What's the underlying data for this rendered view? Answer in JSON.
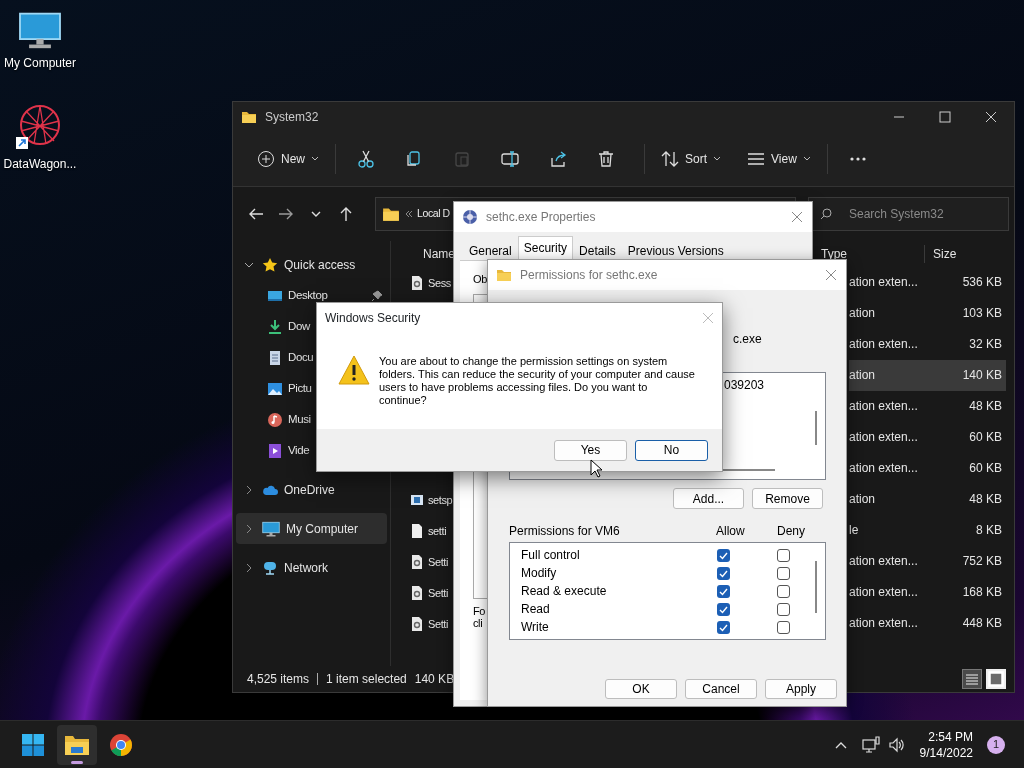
{
  "desktop_icons": [
    {
      "label": "My Computer",
      "kind": "computer"
    },
    {
      "label": "DataWagon...",
      "kind": "app"
    }
  ],
  "explorer": {
    "title": "System32",
    "toolbar": [
      {
        "kind": "new",
        "label": "New",
        "disabled": false
      },
      {
        "kind": "cut",
        "disabled": false
      },
      {
        "kind": "copy",
        "disabled": false
      },
      {
        "kind": "paste",
        "disabled": true
      },
      {
        "kind": "rename",
        "disabled": false
      },
      {
        "kind": "share",
        "disabled": false
      },
      {
        "kind": "delete",
        "disabled": false
      },
      {
        "kind": "sort",
        "label": "Sort",
        "disabled": false
      },
      {
        "kind": "view",
        "label": "View",
        "disabled": false
      },
      {
        "kind": "more",
        "disabled": false
      }
    ],
    "address": "Local D",
    "search": {
      "placeholder": "Search System32"
    },
    "sidebar": [
      {
        "label": "Quick access",
        "kind": "star",
        "expanded": true,
        "selected": false,
        "children": [
          {
            "label": "Desktop",
            "kind": "desktop",
            "pinned": true,
            "selected": false
          },
          {
            "label": "Dow",
            "kind": "downloads",
            "selected": false
          },
          {
            "label": "Docu",
            "kind": "documents",
            "selected": false
          },
          {
            "label": "Pictu",
            "kind": "pictures",
            "selected": false
          },
          {
            "label": "Musi",
            "kind": "music",
            "selected": false
          },
          {
            "label": "Vide",
            "kind": "videos",
            "selected": false
          }
        ]
      },
      {
        "label": "OneDrive",
        "kind": "cloud",
        "expanded": false,
        "selected": false
      },
      {
        "label": "My Computer",
        "kind": "computer",
        "expanded": false,
        "selected": true
      },
      {
        "label": "Network",
        "kind": "network",
        "expanded": false,
        "selected": false
      }
    ],
    "columns": [
      "Name",
      "Type",
      "Size"
    ],
    "rows": [
      {
        "name": "Sess",
        "kind": "settings",
        "type": "ation exten...",
        "size": "536 KB",
        "selected": false
      },
      {
        "type": "ation",
        "size": "103 KB",
        "selected": false
      },
      {
        "type": "ation exten...",
        "size": "32 KB",
        "selected": false
      },
      {
        "type": "ation",
        "size": "140 KB",
        "selected": true
      },
      {
        "type": "ation exten...",
        "size": "48 KB",
        "selected": false
      },
      {
        "type": "ation exten...",
        "size": "60 KB",
        "selected": false
      },
      {
        "type": "ation exten...",
        "size": "60 KB",
        "selected": false
      },
      {
        "name": "setsp",
        "kind": "media",
        "type": "ation",
        "size": "48 KB",
        "selected": false
      },
      {
        "name": "setti",
        "kind": "file",
        "type": "le",
        "size": "8 KB",
        "selected": false
      },
      {
        "name": "Setti",
        "kind": "settings",
        "type": "ation exten...",
        "size": "752 KB",
        "selected": false
      },
      {
        "name": "Setti",
        "kind": "settings",
        "type": "ation exten...",
        "size": "168 KB",
        "selected": false
      },
      {
        "name": "Setti",
        "kind": "settings",
        "type": "ation exten...",
        "size": "448 KB",
        "selected": false
      }
    ],
    "status": {
      "count": "4,525 items",
      "selection": "1 item selected",
      "size": "140 KB"
    },
    "views": [
      {
        "kind": "details",
        "selected": true
      },
      {
        "kind": "tiles",
        "selected": false
      }
    ]
  },
  "properties": {
    "title": "sethc.exe Properties",
    "tabs": [
      {
        "label": "General",
        "selected": false
      },
      {
        "label": "Security",
        "selected": true
      },
      {
        "label": "Details",
        "selected": false
      },
      {
        "label": "Previous Versions",
        "selected": false
      }
    ],
    "fragments": [
      "Ob",
      "Fo",
      "cli"
    ]
  },
  "permissions": {
    "title": "Permissions for sethc.exe",
    "object_fragment": "c.exe",
    "user_fragment": "039203",
    "buttons": [
      "Add...",
      "Remove"
    ],
    "perm_label": "Permissions for VM6",
    "allow_label": "Allow",
    "deny_label": "Deny",
    "perms": [
      {
        "name": "Full control",
        "allow": true,
        "deny": false
      },
      {
        "name": "Modify",
        "allow": true,
        "deny": false
      },
      {
        "name": "Read & execute",
        "allow": true,
        "deny": false
      },
      {
        "name": "Read",
        "allow": true,
        "deny": false
      },
      {
        "name": "Write",
        "allow": true,
        "deny": false
      }
    ],
    "footer": [
      "OK",
      "Cancel",
      "Apply"
    ]
  },
  "security": {
    "title": "Windows Security",
    "message": "You are about to change the permission settings on system folders. This can reduce the security of your computer and cause users to have problems accessing files. Do you want to continue?",
    "buttons": [
      {
        "label": "Yes",
        "default": false
      },
      {
        "label": "No",
        "default": true
      }
    ]
  },
  "taskbar": {
    "apps": [
      {
        "kind": "start",
        "active": false
      },
      {
        "kind": "explorer",
        "active": true
      },
      {
        "kind": "browser",
        "active": false
      }
    ],
    "time": "2:54 PM",
    "date": "9/14/2022",
    "badge": "1"
  }
}
